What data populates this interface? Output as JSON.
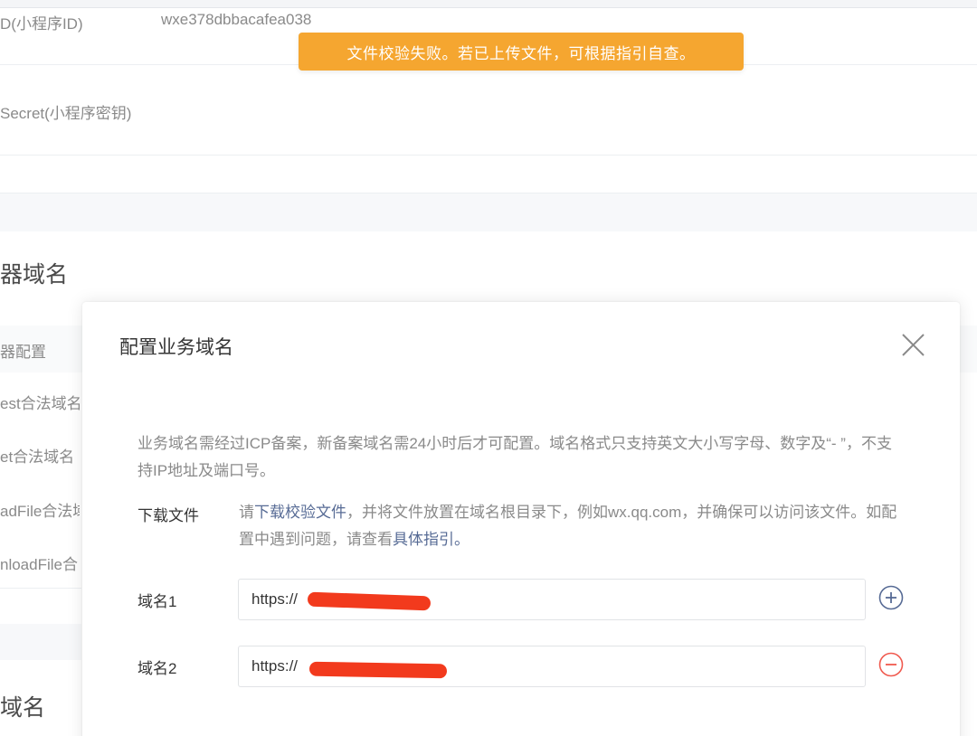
{
  "background": {
    "appid_label": "D(小程序ID)",
    "appid_value": "wxe378dbbacafea038",
    "secret_label": "Secret(小程序密钥)",
    "server_domain_title": "器域名",
    "nav_items": [
      "器配置",
      "est合法域名",
      "et合法域名",
      "adFile合法域",
      "nloadFile合"
    ],
    "business_domain_title": "域名"
  },
  "toast": {
    "message": "文件校验失败。若已上传文件，可根据指引自查。",
    "color": "#f5a630"
  },
  "dialog": {
    "title": "配置业务域名",
    "close_icon": "close-icon",
    "description": "业务域名需经过ICP备案，新备案域名需24小时后才可配置。域名格式只支持英文大小写字母、数字及“- ”，不支持IP地址及端口号。",
    "download": {
      "label": "下载文件",
      "text_before": "请",
      "link_download": "下载校验文件",
      "text_middle": "，并将文件放置在域名根目录下，例如wx.qq.com，并确保可以访问该文件。如配置中遇到问题，请查看",
      "link_guide": "具体指引",
      "text_after": "。"
    },
    "domains": [
      {
        "label": "域名1",
        "value": "https://",
        "action_icon": "plus-circle-icon",
        "action_color": "#576b95"
      },
      {
        "label": "域名2",
        "value": "https://",
        "action_icon": "minus-circle-icon",
        "action_color": "#f05a4f"
      }
    ]
  }
}
